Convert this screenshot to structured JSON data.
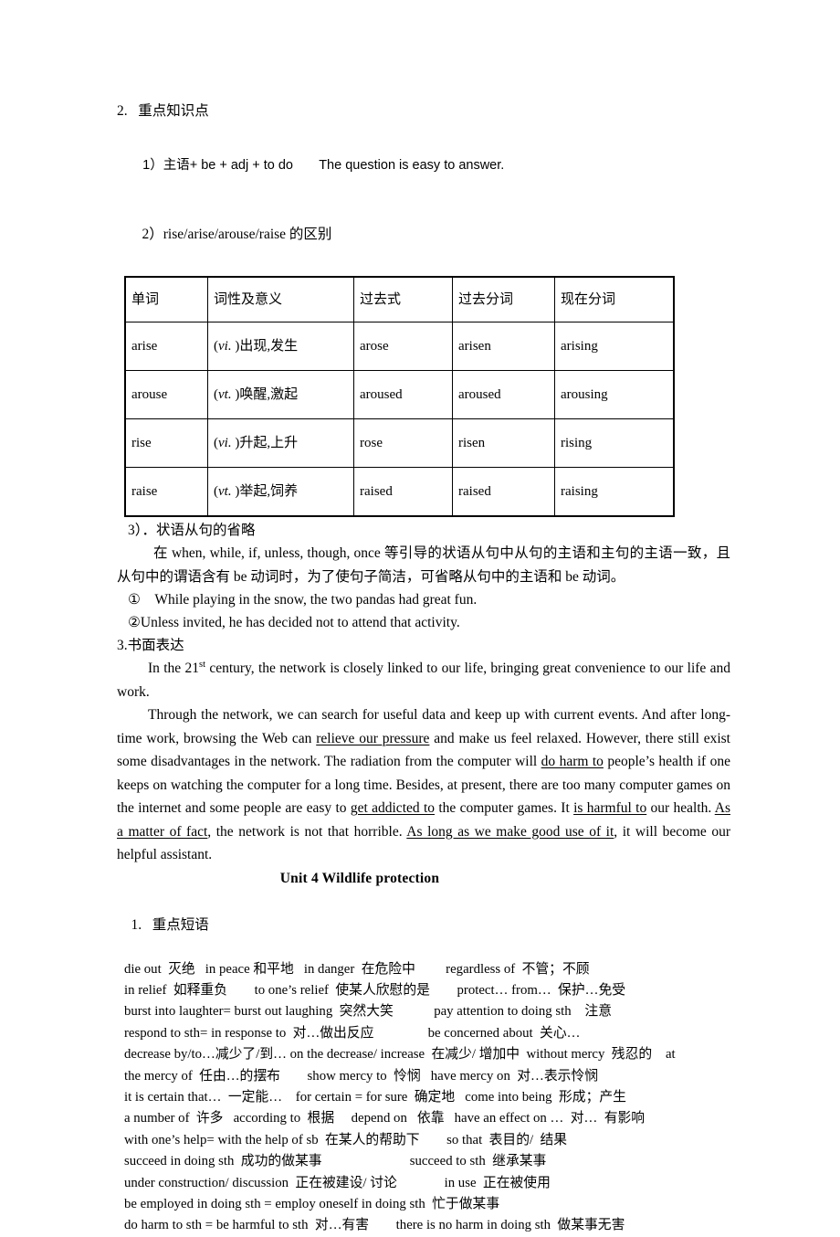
{
  "section2": {
    "number": "2.",
    "title": "重点知识点",
    "point1_label": "1）",
    "point1_pattern": "主语+ be + adj + to do",
    "point1_example": "The question is easy to answer.",
    "point2_label": "2）",
    "point2_title": "rise/arise/arouse/raise 的区别"
  },
  "verb_table": {
    "headers": [
      "单词",
      "词性及意义",
      "过去式",
      "过去分词",
      "现在分词"
    ],
    "rows": [
      {
        "word": "arise",
        "pos": "vi.",
        "meaning": "出现,发生",
        "past": "arose",
        "pp": "arisen",
        "ing": "arising"
      },
      {
        "word": "arouse",
        "pos": "vt.",
        "meaning": "唤醒,激起",
        "past": "aroused",
        "pp": "aroused",
        "ing": "arousing"
      },
      {
        "word": "rise",
        "pos": "vi.",
        "meaning": "升起,上升",
        "past": "rose",
        "pp": "risen",
        "ing": "rising"
      },
      {
        "word": "raise",
        "pos": "vt.",
        "meaning": "举起,饲养",
        "past": "raised",
        "pp": "raised",
        "ing": "raising"
      }
    ]
  },
  "section3_clause": {
    "label": "3）．状语从句的省略",
    "body": "在 when, while, if, unless, though, once 等引导的状语从句中从句的主语和主句的主语一致，且从句中的谓语含有 be 动词时，为了使句子简洁，可省略从句中的主语和 be 动词。",
    "example1": "①　While playing in the snow, the two pandas had great fun.",
    "example2": "②Unless invited, he has decided not to attend that activity."
  },
  "writing": {
    "heading": "3.书面表达",
    "para1_a": "In the 21",
    "para1_sup": "st",
    "para1_b": " century, the network is closely linked to our life, bringing great convenience to our life and work.",
    "para2": [
      {
        "t": "Through the network, we can search for useful data and keep up with current events. And after long-time work, browsing the Web can ",
        "u": false
      },
      {
        "t": "relieve our pressure",
        "u": true
      },
      {
        "t": " and make us feel relaxed. However, there still exist some disadvantages in the network. The radiation from the computer will ",
        "u": false
      },
      {
        "t": "do harm to",
        "u": true
      },
      {
        "t": " people’s health if one keeps on watching the computer for a long time. Besides, at present, there are too many computer games on the internet and some people are easy to ",
        "u": false
      },
      {
        "t": "get addicted to",
        "u": true
      },
      {
        "t": " the computer games. It ",
        "u": false
      },
      {
        "t": "is harmful to",
        "u": true
      },
      {
        "t": " our health. ",
        "u": false
      },
      {
        "t": "As a matter of fact",
        "u": true
      },
      {
        "t": ", the network is not that horrible. ",
        "u": false
      },
      {
        "t": "As long as we make good use of it",
        "u": true
      },
      {
        "t": ", it will become our helpful assistant.",
        "u": false
      }
    ]
  },
  "unit4": {
    "title": "Unit 4     Wildlife protection",
    "section1_number": "1.",
    "section1_title": "重点短语",
    "phrases": [
      "die out  灭绝   in peace 和平地   in danger  在危险中         regardless of  不管；不顾",
      "in relief  如释重负        to one’s relief  使某人欣慰的是        protect… from…  保护…免受",
      "burst into laughter= burst out laughing  突然大笑            pay attention to doing sth    注意",
      "respond to sth= in response to  对…做出反应                be concerned about  关心…",
      "decrease by/to…减少了/到… on the decrease/ increase  在减少/ 增加中  without mercy  残忍的    at",
      "the mercy of  任由…的摆布        show mercy to  怜悯   have mercy on  对…表示怜悯",
      "it is certain that…  一定能…    for certain = for sure  确定地   come into being  形成；产生",
      "a number of  许多   according to  根据     depend on   依靠   have an effect on …  对…  有影响",
      "with one’s help= with the help of sb  在某人的帮助下        so that  表目的/  结果",
      "succeed in doing sth  成功的做某事                          succeed to sth  继承某事",
      "under construction/ discussion  正在被建设/ 讨论              in use  正在被使用",
      "be employed in doing sth = employ oneself in doing sth  忙于做某事",
      "do harm to sth = be harmful to sth  对…有害        there is no harm in doing sth  做某事无害"
    ]
  }
}
